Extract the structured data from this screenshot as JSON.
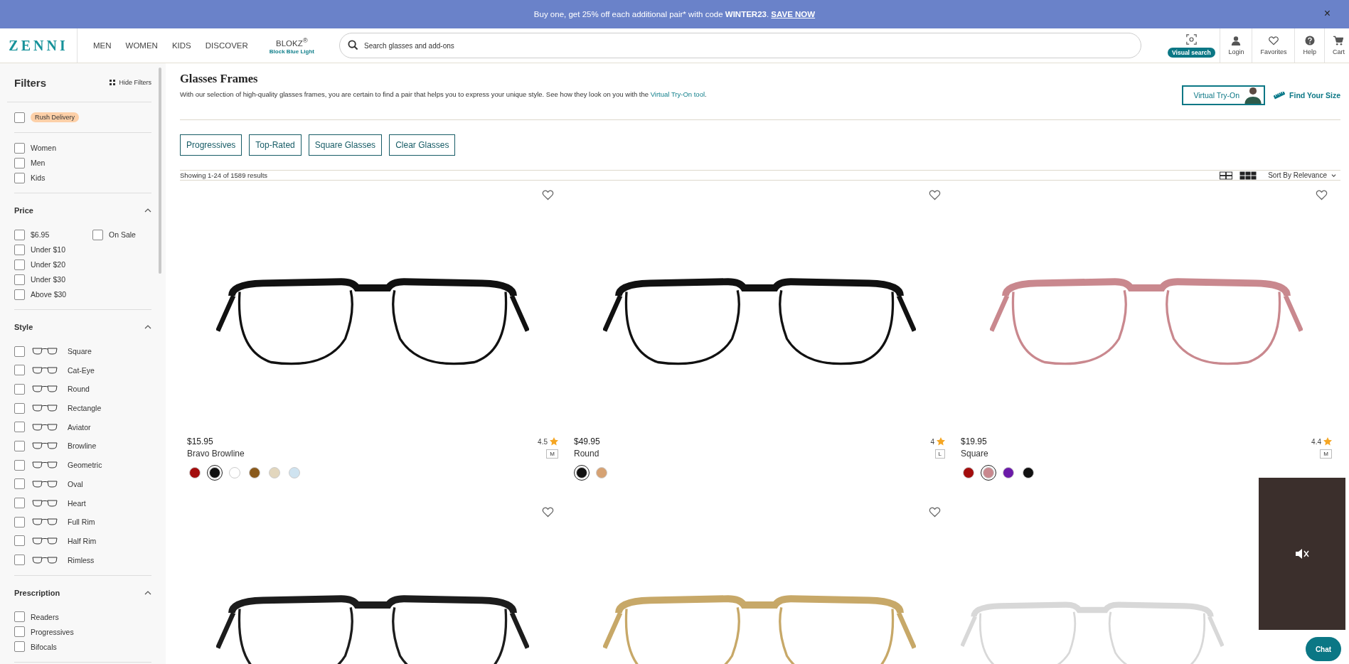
{
  "banner": {
    "text": "Buy one, get 25% off each additional pair* with code **WINTER23**.",
    "link": "SAVE NOW",
    "close": "×"
  },
  "header": {
    "logo": "ZENNI",
    "nav": [
      {
        "label": "MEN"
      },
      {
        "label": "WOMEN"
      },
      {
        "label": "KIDS"
      },
      {
        "label": "DISCOVER"
      },
      {
        "label": "BLOKZ$^{®}$",
        "sub": "Block Blue Light"
      }
    ],
    "search": {
      "placeholder": "Search glasses and add-ons"
    },
    "visual_search": "Visual search",
    "actions": [
      {
        "kind": "login",
        "label": "Login"
      },
      {
        "kind": "favorites",
        "label": "Favorites"
      },
      {
        "kind": "help",
        "label": "Help"
      },
      {
        "kind": "cart",
        "label": "Cart"
      }
    ]
  },
  "filters": {
    "title": "Filters",
    "hide": "Hide Filters",
    "sections": [
      {
        "options": [
          {
            "label": "Rush Delivery",
            "kind": "tag",
            "checked": false
          }
        ]
      },
      {
        "options": [
          {
            "label": "Women",
            "checked": false
          },
          {
            "label": "Men",
            "checked": false
          },
          {
            "label": "Kids",
            "checked": false
          }
        ]
      },
      {
        "title": "Price",
        "expanded": true,
        "kind": "price",
        "options": [
          {
            "label": "$6.95",
            "checked": false
          },
          {
            "label": "On Sale",
            "checked": false
          },
          {
            "label": "Under $10",
            "checked": false
          },
          {
            "label": "Under $20",
            "checked": false
          },
          {
            "label": "Under $30",
            "checked": false
          },
          {
            "label": "Above $30",
            "checked": false
          }
        ]
      },
      {
        "title": "Style",
        "expanded": true,
        "kind": "style",
        "options": [
          {
            "label": "Square",
            "checked": false
          },
          {
            "label": "Cat-Eye",
            "checked": false
          },
          {
            "label": "Round",
            "checked": false
          },
          {
            "label": "Rectangle",
            "checked": false
          },
          {
            "label": "Aviator",
            "checked": false
          },
          {
            "label": "Browline",
            "checked": false
          },
          {
            "label": "Geometric",
            "checked": false
          },
          {
            "label": "Oval",
            "checked": false
          },
          {
            "label": "Heart",
            "checked": false
          },
          {
            "label": "Full Rim",
            "checked": false
          },
          {
            "label": "Half Rim",
            "checked": false
          },
          {
            "label": "Rimless",
            "checked": false
          }
        ]
      },
      {
        "title": "Prescription",
        "expanded": true,
        "options": [
          {
            "label": "Readers",
            "checked": false
          },
          {
            "label": "Progressives",
            "checked": false
          },
          {
            "label": "Bifocals",
            "checked": false
          }
        ]
      }
    ]
  },
  "page": {
    "title": "Glasses Frames",
    "description": "With our selection of high-quality glasses frames, you are certain to find a pair that helps you to express your unique style. See how they look on you with the",
    "description_link": "Virtual Try-On tool",
    "description_end": ".",
    "try_on": "Virtual Try-On",
    "find_size": "Find Your Size",
    "chips": [
      "Progressives",
      "Top-Rated",
      "Square Glasses",
      "Clear Glasses"
    ],
    "results": "Showing 1-24 of 1589 results",
    "views": [
      {
        "kind": "grid-2",
        "selected": false
      },
      {
        "kind": "grid-3",
        "selected": true
      }
    ],
    "sort": "Sort By Relevance"
  },
  "products": [
    {
      "price": "$15.95",
      "name": "Bravo Browline",
      "rating": "4.5",
      "size": "M",
      "favorite": false,
      "swatches": [
        {
          "color": "#a30d0d",
          "selected": false
        },
        {
          "color": "#111111",
          "selected": true
        },
        {
          "color": "#ffffff",
          "selected": false
        },
        {
          "color": "#8a5a1c",
          "selected": false
        },
        {
          "color": "#e2d6bd",
          "selected": false
        },
        {
          "color": "#cfe3f0",
          "selected": false
        }
      ]
    },
    {
      "price": "$49.95",
      "name": "Round",
      "rating": "4",
      "size": "L",
      "favorite": false,
      "swatches": [
        {
          "color": "#111111",
          "selected": true
        },
        {
          "color": "#d6a273",
          "selected": false
        }
      ]
    },
    {
      "price": "$19.95",
      "name": "Square",
      "rating": "4.4",
      "size": "M",
      "favorite": false,
      "swatches": [
        {
          "color": "#a30d0d",
          "selected": false
        },
        {
          "color": "#c9888e",
          "selected": true
        },
        {
          "color": "#6b1aa8",
          "selected": false
        },
        {
          "color": "#111111",
          "selected": false
        }
      ]
    },
    {
      "kind": "metal",
      "favorite": false
    },
    {
      "kind": "gold",
      "favorite": false
    },
    {
      "kind": "clear"
    }
  ],
  "chat": "Chat"
}
